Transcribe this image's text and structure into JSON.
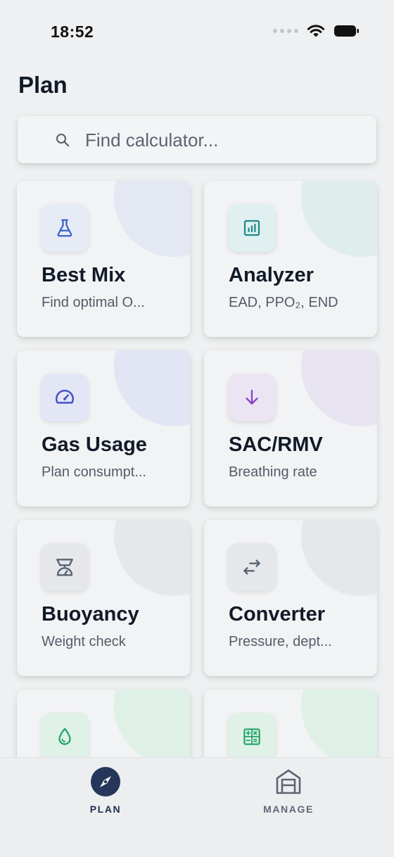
{
  "status_bar": {
    "time": "18:52",
    "icons": [
      "signal-dots-icon",
      "wifi-icon",
      "battery-icon"
    ]
  },
  "header": {
    "title": "Plan"
  },
  "search": {
    "placeholder": "Find calculator..."
  },
  "cards": [
    {
      "title": "Best Mix",
      "subtitle": "Find optimal O...",
      "icon": "flask-icon",
      "accent": "#3b63c7"
    },
    {
      "title": "Analyzer",
      "subtitle": "EAD, PPO₂, END",
      "icon": "bar-chart-icon",
      "accent": "#1d8a8a"
    },
    {
      "title": "Gas Usage",
      "subtitle": "Plan consumpt...",
      "icon": "gauge-icon",
      "accent": "#4652c8"
    },
    {
      "title": "SAC/RMV",
      "subtitle": "Breathing rate",
      "icon": "arrow-down-icon",
      "accent": "#8a45c9"
    },
    {
      "title": "Buoyancy",
      "subtitle": "Weight check",
      "icon": "scale-icon",
      "accent": "#596472"
    },
    {
      "title": "Converter",
      "subtitle": "Pressure, dept...",
      "icon": "swap-arrows-icon",
      "accent": "#596472"
    },
    {
      "title": "",
      "subtitle": "",
      "icon": "droplet-icon",
      "accent": "#20a468"
    },
    {
      "title": "",
      "subtitle": "",
      "icon": "calculator-icon",
      "accent": "#20a468"
    }
  ],
  "tab_bar": {
    "tabs": [
      {
        "label": "PLAN",
        "icon": "compass-icon",
        "active": true
      },
      {
        "label": "MANAGE",
        "icon": "cabinet-icon",
        "active": false
      }
    ]
  }
}
